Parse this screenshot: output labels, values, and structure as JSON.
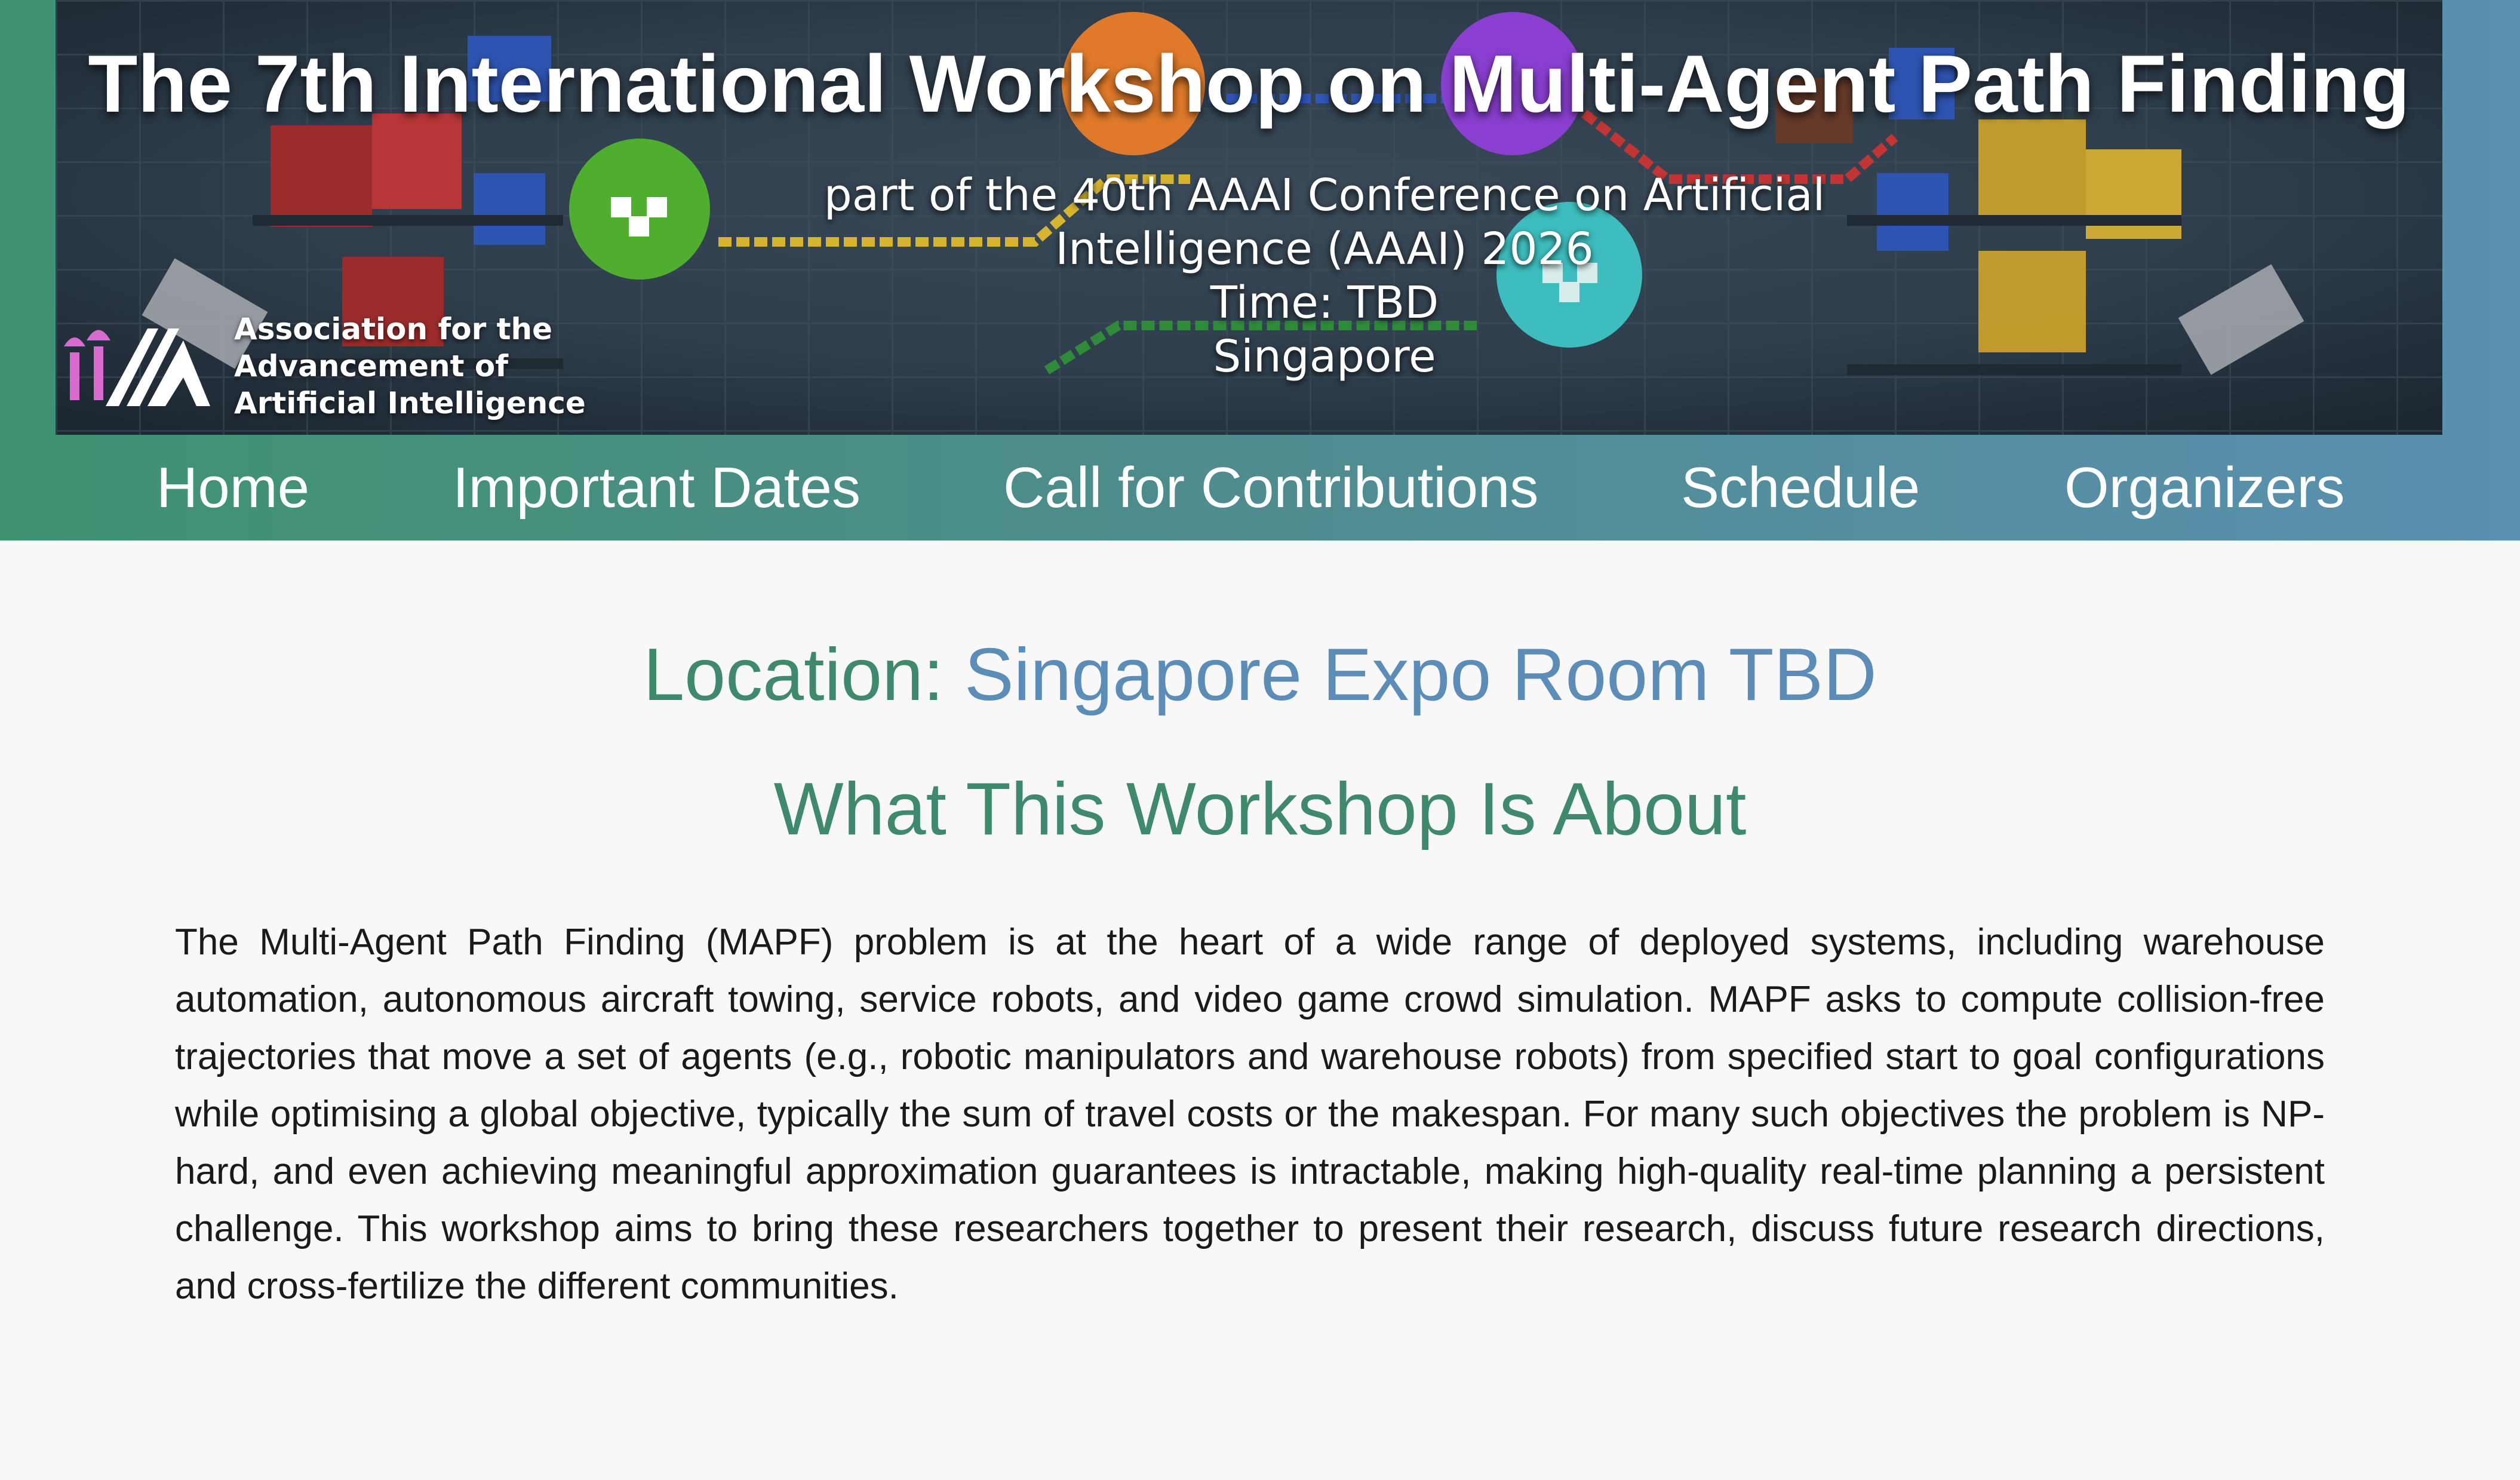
{
  "banner": {
    "title": "The 7th International Workshop on Multi-Agent Path Finding",
    "subtitle_line1": "part of the 40th AAAI Conference on Artificial",
    "subtitle_line2": "Intelligence (AAAI) 2026",
    "time": "Time: TBD",
    "place": "Singapore",
    "aaai_logo": {
      "line1": "Association for the",
      "line2": "Advancement of",
      "line3": "Artificial Intelligence"
    }
  },
  "nav": {
    "items": [
      {
        "label": "Home"
      },
      {
        "label": "Important Dates"
      },
      {
        "label": "Call for Contributions"
      },
      {
        "label": "Schedule"
      },
      {
        "label": "Organizers"
      }
    ]
  },
  "main": {
    "location_label": "Location:",
    "location_value": "Singapore Expo Room TBD",
    "about_heading": "What This Workshop Is About",
    "about_text": "The Multi-Agent Path Finding (MAPF) problem is at the heart of a wide range of deployed systems, including warehouse automation, autonomous aircraft towing, service robots, and video game crowd simulation. MAPF asks to compute collision-free trajectories that move a set of agents (e.g., robotic manipulators and warehouse robots) from specified start to goal configurations while optimising a global objective, typically the sum of travel costs or the makespan. For many such objectives the problem is NP-hard, and even achieving meaningful approximation guarantees is intractable, making high-quality real-time planning a persistent challenge. This workshop aims to bring these researchers together to present their research, discuss future research directions, and cross-fertilize the different communities."
  },
  "colors": {
    "green_accent": "#3f8a6c",
    "blue_accent": "#5b8db8",
    "nav_gradient_start": "#3f9371",
    "nav_gradient_end": "#5a90b0"
  }
}
